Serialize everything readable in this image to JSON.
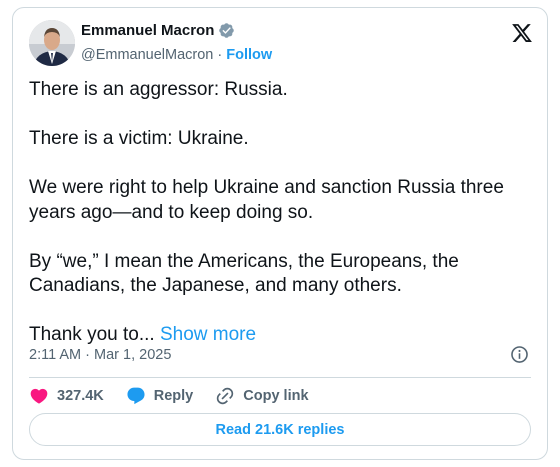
{
  "author": {
    "name": "Emmanuel Macron",
    "handle": "@EmmanuelMacron",
    "separator": "·",
    "follow_label": "Follow"
  },
  "tweet": {
    "paragraphs": [
      "There is an aggressor: Russia.",
      "There is a victim: Ukraine.",
      "We were right to help Ukraine and sanction Russia three years ago—and to keep doing so.",
      "By “we,” I mean the Americans, the Europeans, the Canadians, the Japanese, and many others."
    ],
    "truncated_text": "Thank you to...",
    "show_more_label": "Show more"
  },
  "meta": {
    "timestamp": "2:11 AM · Mar 1, 2025"
  },
  "actions": {
    "like_count": "327.4K",
    "reply_label": "Reply",
    "copy_link_label": "Copy link"
  },
  "replies_button_label": "Read 21.6K replies",
  "colors": {
    "accent": "#1d9bf0",
    "like": "#f91880",
    "muted": "#536471",
    "border": "#cfd9de"
  },
  "icons": [
    "verified-badge-icon",
    "x-logo-icon",
    "info-icon",
    "heart-icon",
    "reply-bubble-icon",
    "link-icon"
  ]
}
